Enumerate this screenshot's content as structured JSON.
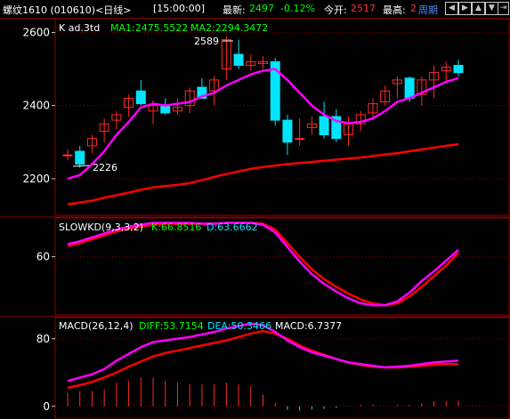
{
  "header": {
    "symbol": "螺纹1610 (010610)<日线>",
    "time": "[15:00:00]",
    "latest_label": "最新:",
    "latest_value": "2497",
    "change": "-0.12%",
    "open_interest_label": "今开:",
    "open_interest_value": "2517",
    "high_label": "最高:",
    "high_value": "2",
    "period": "周期",
    "nav_icons": [
      "arrow-left-icon",
      "arrow-right-icon",
      "arrow-up-icon",
      "arrow-down-icon",
      "exit-icon"
    ]
  },
  "colors": {
    "bg": "#000000",
    "grid": "#8b0000",
    "up": "#ff2a2a",
    "down": "#00e5ff",
    "ma1": "#ff00ff",
    "ma2": "#ff0000",
    "k": "#ff00ff",
    "d": "#ff0000",
    "diff": "#ff00ff",
    "dea": "#ff0000"
  },
  "chart_data": [
    {
      "type": "candlestick",
      "title": "K ad.3td",
      "ma1_label": "MA1:2475.5522",
      "ma2_label": "MA2:2294.3472",
      "ylim": [
        2100,
        2640
      ],
      "yticks": [
        2200,
        2400,
        2600
      ],
      "annotations": [
        "2589",
        "2226"
      ],
      "candles": [
        {
          "o": 2265,
          "h": 2280,
          "l": 2250,
          "c": 2265
        },
        {
          "o": 2275,
          "h": 2290,
          "l": 2230,
          "c": 2240
        },
        {
          "o": 2290,
          "h": 2320,
          "l": 2270,
          "c": 2310
        },
        {
          "o": 2330,
          "h": 2365,
          "l": 2300,
          "c": 2350
        },
        {
          "o": 2360,
          "h": 2385,
          "l": 2335,
          "c": 2375
        },
        {
          "o": 2395,
          "h": 2430,
          "l": 2370,
          "c": 2420
        },
        {
          "o": 2440,
          "h": 2470,
          "l": 2400,
          "c": 2405
        },
        {
          "o": 2385,
          "h": 2415,
          "l": 2350,
          "c": 2400
        },
        {
          "o": 2400,
          "h": 2420,
          "l": 2375,
          "c": 2380
        },
        {
          "o": 2385,
          "h": 2420,
          "l": 2375,
          "c": 2395
        },
        {
          "o": 2400,
          "h": 2450,
          "l": 2380,
          "c": 2440
        },
        {
          "o": 2450,
          "h": 2475,
          "l": 2420,
          "c": 2420
        },
        {
          "o": 2440,
          "h": 2480,
          "l": 2400,
          "c": 2470
        },
        {
          "o": 2500,
          "h": 2589,
          "l": 2470,
          "c": 2580
        },
        {
          "o": 2540,
          "h": 2580,
          "l": 2500,
          "c": 2510
        },
        {
          "o": 2510,
          "h": 2540,
          "l": 2495,
          "c": 2520
        },
        {
          "o": 2515,
          "h": 2535,
          "l": 2500,
          "c": 2520
        },
        {
          "o": 2520,
          "h": 2530,
          "l": 2345,
          "c": 2360
        },
        {
          "o": 2360,
          "h": 2375,
          "l": 2265,
          "c": 2300
        },
        {
          "o": 2310,
          "h": 2365,
          "l": 2290,
          "c": 2310
        },
        {
          "o": 2340,
          "h": 2370,
          "l": 2320,
          "c": 2350
        },
        {
          "o": 2370,
          "h": 2410,
          "l": 2310,
          "c": 2320
        },
        {
          "o": 2370,
          "h": 2390,
          "l": 2300,
          "c": 2310
        },
        {
          "o": 2320,
          "h": 2370,
          "l": 2290,
          "c": 2350
        },
        {
          "o": 2350,
          "h": 2385,
          "l": 2330,
          "c": 2375
        },
        {
          "o": 2380,
          "h": 2420,
          "l": 2360,
          "c": 2405
        },
        {
          "o": 2410,
          "h": 2455,
          "l": 2400,
          "c": 2440
        },
        {
          "o": 2460,
          "h": 2480,
          "l": 2420,
          "c": 2470
        },
        {
          "o": 2475,
          "h": 2480,
          "l": 2410,
          "c": 2420
        },
        {
          "o": 2430,
          "h": 2480,
          "l": 2400,
          "c": 2470
        },
        {
          "o": 2470,
          "h": 2510,
          "l": 2420,
          "c": 2490
        },
        {
          "o": 2495,
          "h": 2520,
          "l": 2460,
          "c": 2505
        },
        {
          "o": 2510,
          "h": 2525,
          "l": 2480,
          "c": 2490
        }
      ],
      "ma1": [
        2200,
        2210,
        2240,
        2275,
        2320,
        2355,
        2395,
        2405,
        2400,
        2405,
        2410,
        2425,
        2435,
        2455,
        2470,
        2485,
        2495,
        2500,
        2470,
        2435,
        2400,
        2375,
        2358,
        2352,
        2355,
        2365,
        2385,
        2410,
        2420,
        2435,
        2450,
        2465,
        2475
      ],
      "ma2": [
        2130,
        2135,
        2140,
        2148,
        2155,
        2162,
        2170,
        2176,
        2180,
        2183,
        2188,
        2196,
        2205,
        2213,
        2220,
        2227,
        2232,
        2236,
        2240,
        2243,
        2246,
        2249,
        2252,
        2255,
        2258,
        2262,
        2266,
        2270,
        2275,
        2280,
        2285,
        2290,
        2294
      ]
    },
    {
      "type": "line",
      "title": "SLOWKD(9,3,3,2)",
      "k_label": "K:66.8516",
      "d_label": "D:63.6662",
      "ylim": [
        0,
        100
      ],
      "yticks": [
        60
      ],
      "series": [
        {
          "name": "K",
          "values": [
            73,
            76,
            80,
            84,
            88,
            91,
            93,
            95,
            95,
            95,
            95,
            94,
            94,
            95,
            95,
            95,
            93,
            85,
            70,
            55,
            42,
            32,
            24,
            17,
            12,
            10,
            10,
            14,
            23,
            35,
            45,
            56,
            67
          ]
        },
        {
          "name": "D",
          "values": [
            71,
            74,
            78,
            82,
            86,
            89,
            91,
            93,
            94,
            94,
            94,
            94,
            94,
            95,
            95,
            95,
            94,
            88,
            74,
            60,
            47,
            37,
            29,
            22,
            16,
            12,
            10,
            12,
            19,
            29,
            40,
            51,
            64
          ]
        }
      ]
    },
    {
      "type": "line",
      "title": "MACD(26,12,4)",
      "diff_label": "DIFF:53.7154",
      "dea_label": "DEA:50.3466",
      "macd_label": "MACD:6.7377",
      "ylim": [
        -15,
        105
      ],
      "yticks": [
        0,
        80
      ],
      "series": [
        {
          "name": "DIFF",
          "values": [
            30,
            34,
            38,
            44,
            54,
            62,
            70,
            76,
            78,
            80,
            82,
            85,
            88,
            92,
            95,
            98,
            96,
            88,
            78,
            70,
            64,
            60,
            56,
            52,
            50,
            48,
            46,
            47,
            48,
            50,
            52,
            53,
            54
          ]
        },
        {
          "name": "DEA",
          "values": [
            22,
            25,
            29,
            34,
            40,
            47,
            53,
            59,
            63,
            66,
            69,
            72,
            75,
            78,
            82,
            86,
            89,
            86,
            80,
            72,
            66,
            61,
            56,
            52,
            49,
            47,
            46,
            46,
            47,
            48,
            49,
            50,
            50
          ]
        },
        {
          "name": "MACD",
          "values": [
            16,
            18,
            18,
            20,
            28,
            30,
            34,
            34,
            30,
            28,
            26,
            26,
            26,
            28,
            26,
            24,
            14,
            4,
            -4,
            -5,
            -4,
            -3,
            -2,
            0,
            2,
            2,
            0,
            2,
            2,
            4,
            6,
            6,
            7
          ]
        }
      ]
    }
  ]
}
